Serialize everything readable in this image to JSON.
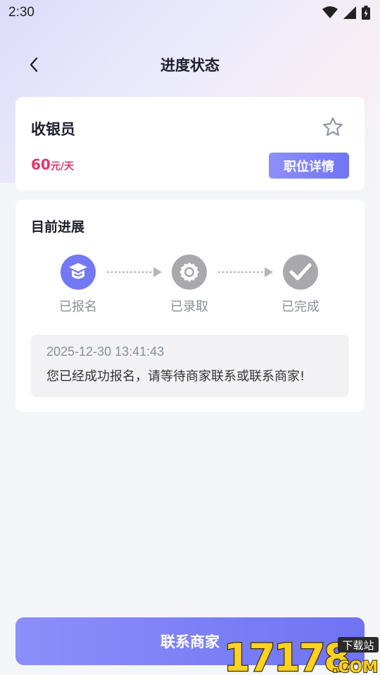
{
  "status_bar": {
    "time": "2:30",
    "icons": [
      "wifi-icon",
      "signal-icon",
      "battery-icon"
    ]
  },
  "header": {
    "title": "进度状态",
    "back_icon": "chevron-left-icon"
  },
  "job": {
    "title": "收银员",
    "salary_amount": "60",
    "salary_unit": "元/天",
    "detail_button": "职位详情",
    "favorite_icon": "star-outline-icon"
  },
  "progress": {
    "title": "目前进展",
    "steps": [
      {
        "label": "已报名",
        "icon": "graduation-cap-icon",
        "state": "active"
      },
      {
        "label": "已录取",
        "icon": "badge-icon",
        "state": "inactive"
      },
      {
        "label": "已完成",
        "icon": "check-icon",
        "state": "inactive"
      }
    ],
    "log": {
      "time": "2025-12-30 13:41:43",
      "message": "您已经成功报名，请等待商家联系或联系商家!"
    }
  },
  "footer": {
    "contact_button": "联系商家"
  },
  "watermark": {
    "text": "17178",
    "suffix": ".COM",
    "tag": "下载站"
  },
  "colors": {
    "accent": "#7378f4",
    "salary": "#e6336a",
    "inactive_step": "#a9a9ad",
    "watermark_yellow": "#ffd21f"
  }
}
